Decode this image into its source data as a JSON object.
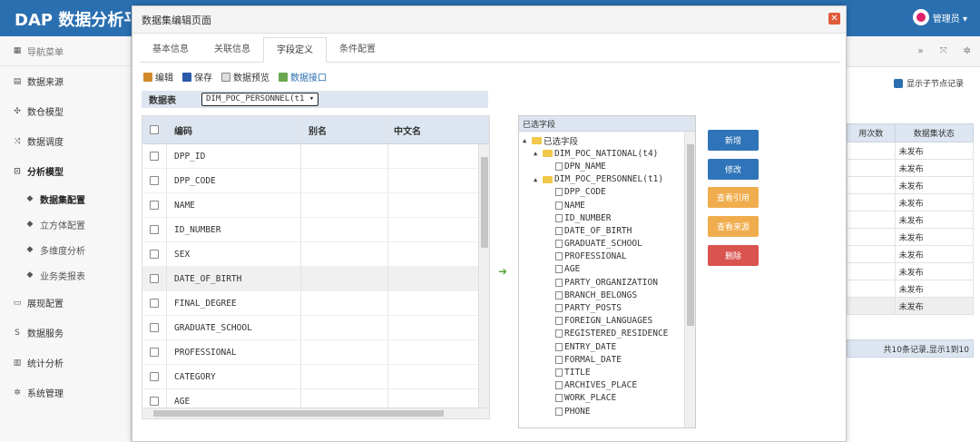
{
  "app": {
    "brand": "DAP 数据分析平",
    "user": "管理员 ▾"
  },
  "colors": {
    "primary": "#2a6fb0",
    "new": "#2f74b8",
    "edit": "#2f74b8",
    "view_ref": "#f0ad4e",
    "view_src": "#f0ad4e",
    "delete": "#d9534f"
  },
  "sidebar": {
    "header": "导航菜单",
    "items": [
      {
        "label": "数据来源",
        "icon": "database-icon"
      },
      {
        "label": "数仓模型",
        "icon": "network-icon"
      },
      {
        "label": "数据调度",
        "icon": "shuffle-icon"
      },
      {
        "label": "分析模型",
        "icon": "model-icon"
      },
      {
        "label": "数据集配置",
        "icon": "tag-icon"
      },
      {
        "label": "立方体配置",
        "icon": "tag-icon"
      },
      {
        "label": "多维度分析",
        "icon": "tag-icon"
      },
      {
        "label": "业务类报表",
        "icon": "tag-icon"
      },
      {
        "label": "展现配置",
        "icon": "display-icon"
      },
      {
        "label": "数据服务",
        "icon": "service-icon"
      },
      {
        "label": "统计分析",
        "icon": "chart-icon"
      },
      {
        "label": "系统管理",
        "icon": "gear-icon"
      }
    ]
  },
  "background": {
    "checkbox_label": "显示子节点记录",
    "col1": "用次数",
    "col2": "数据集状态",
    "rows": [
      "未发布",
      "未发布",
      "未发布",
      "未发布",
      "未发布",
      "未发布",
      "未发布",
      "未发布",
      "未发布",
      "未发布"
    ],
    "footer": "共10条记录,显示1到10"
  },
  "dialog": {
    "title": "数据集编辑页面",
    "tabs": [
      "基本信息",
      "关联信息",
      "字段定义",
      "条件配置"
    ],
    "toolbar": {
      "edit": "编辑",
      "save": "保存",
      "preview": "数据预览",
      "interface": "数据接口"
    },
    "datatable_label": "数据表",
    "datatable_value": "DIM_POC_PERSONNEL(t1 ▾",
    "grid_headers": {
      "code": "编码",
      "alias": "别名",
      "cname": "中文名"
    },
    "grid_rows": [
      "DPP_ID",
      "DPP_CODE",
      "NAME",
      "ID_NUMBER",
      "SEX",
      "DATE_OF_BIRTH",
      "FINAL_DEGREE",
      "GRADUATE_SCHOOL",
      "PROFESSIONAL",
      "CATEGORY",
      "AGE"
    ],
    "tree_title": "已选字段",
    "tree_root": "已选字段",
    "tree_group1": "DIM_POC_NATIONAL(t4)",
    "tree_group1_items": [
      "DPN_NAME"
    ],
    "tree_group2": "DIM_POC_PERSONNEL(t1)",
    "tree_group2_items": [
      "DPP_CODE",
      "NAME",
      "ID_NUMBER",
      "DATE_OF_BIRTH",
      "GRADUATE_SCHOOL",
      "PROFESSIONAL",
      "AGE",
      "PARTY_ORGANIZATION",
      "BRANCH_BELONGS",
      "PARTY_POSTS",
      "FOREIGN_LANGUAGES",
      "REGISTERED_RESIDENCE",
      "ENTRY_DATE",
      "FORMAL_DATE",
      "TITLE",
      "ARCHIVES_PLACE",
      "WORK_PLACE",
      "PHONE"
    ],
    "buttons": {
      "new": "新增",
      "edit": "修改",
      "view_ref": "查看引用",
      "view_src": "查看来源",
      "delete": "删除"
    }
  }
}
